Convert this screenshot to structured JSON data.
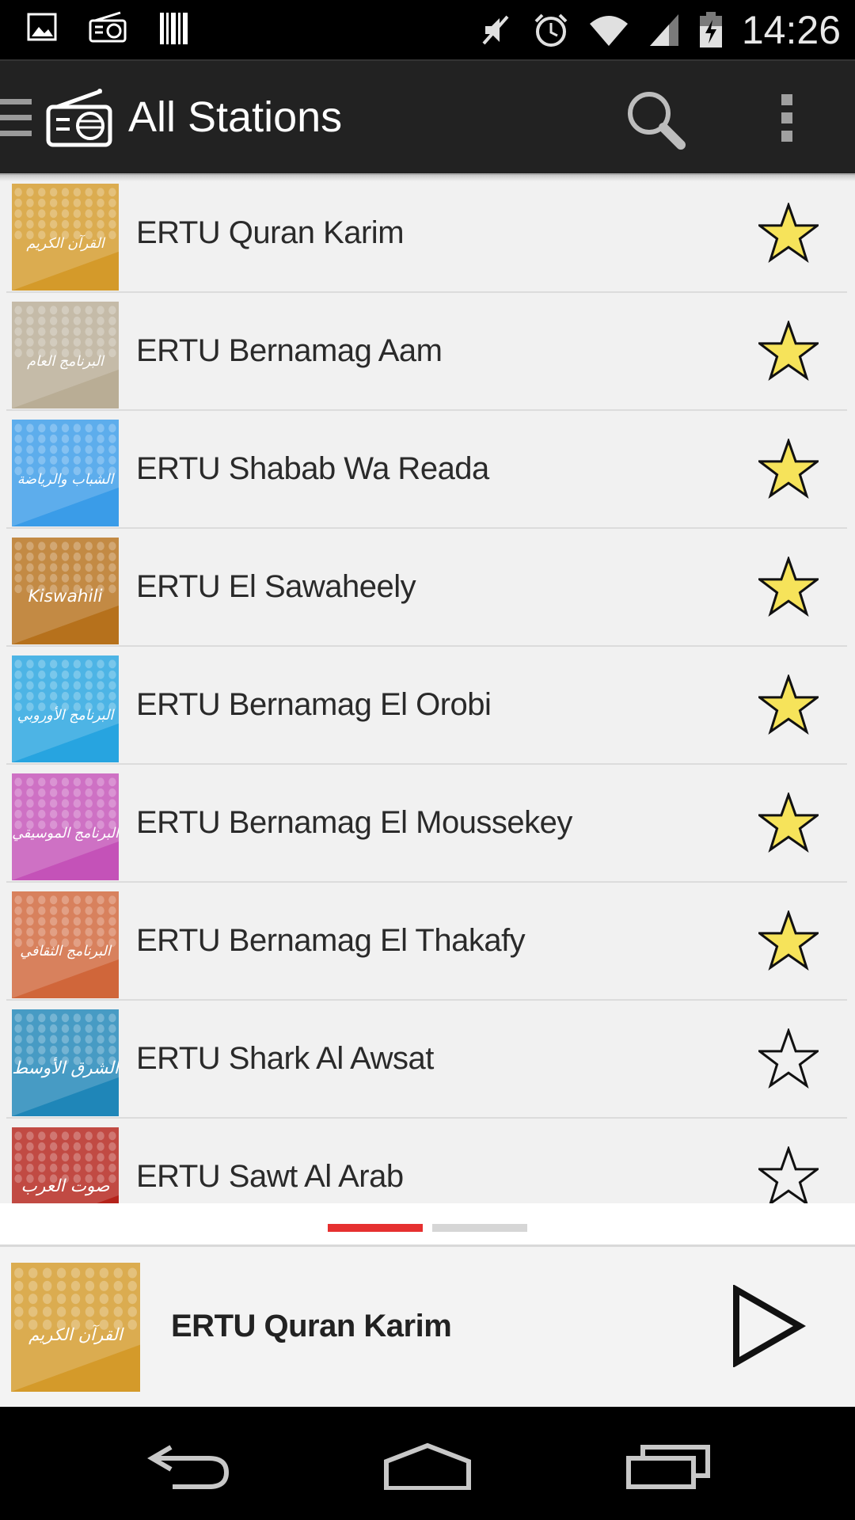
{
  "status_bar": {
    "time": "14:26",
    "left_icons": [
      "image-icon",
      "radio-icon",
      "barcode-icon"
    ],
    "right_icons": [
      "mute-icon",
      "alarm-icon",
      "wifi-icon",
      "signal-icon",
      "battery-charging-icon"
    ]
  },
  "action_bar": {
    "title": "All Stations",
    "icons": [
      "drawer-icon",
      "radio-app-icon",
      "search-icon",
      "overflow-menu-icon"
    ]
  },
  "stations": [
    {
      "name": "ERTU Quran Karim",
      "favorite": true,
      "thumb_color": "#d49a2a",
      "thumb_text": "القرآن الكريم"
    },
    {
      "name": "ERTU Bernamag Aam",
      "favorite": true,
      "thumb_color": "#b9ad95",
      "thumb_text": "البرنامج العام"
    },
    {
      "name": "ERTU Shabab Wa Reada",
      "favorite": true,
      "thumb_color": "#3a9ce8",
      "thumb_text": "الشباب والرياضة"
    },
    {
      "name": "ERTU El Sawaheely",
      "favorite": true,
      "thumb_color": "#b6711c",
      "thumb_text": "Kiswahili"
    },
    {
      "name": "ERTU Bernamag El Orobi",
      "favorite": true,
      "thumb_color": "#27a4e0",
      "thumb_text": "البرنامج الأوروبي"
    },
    {
      "name": "ERTU Bernamag El Moussekey",
      "favorite": true,
      "thumb_color": "#c452b8",
      "thumb_text": "البرنامج الموسيقي"
    },
    {
      "name": "ERTU Bernamag El Thakafy",
      "favorite": true,
      "thumb_color": "#d0663a",
      "thumb_text": "البرنامج الثقافي"
    },
    {
      "name": "ERTU Shark Al Awsat",
      "favorite": false,
      "thumb_color": "#1f86b8",
      "thumb_text": "الشرق الأوسط"
    },
    {
      "name": "ERTU Sawt Al Arab",
      "favorite": false,
      "thumb_color": "#b4231a",
      "thumb_text": "صوت العرب"
    }
  ],
  "pager": {
    "pages": 2,
    "active_page": 1,
    "active_color": "#e63030"
  },
  "now_playing": {
    "title": "ERTU Quran Karim",
    "thumb_color": "#d49a2a",
    "thumb_text": "القرآن الكريم",
    "control": "play-icon"
  },
  "nav_bar": {
    "buttons": [
      "back-icon",
      "home-icon",
      "recents-icon"
    ]
  }
}
